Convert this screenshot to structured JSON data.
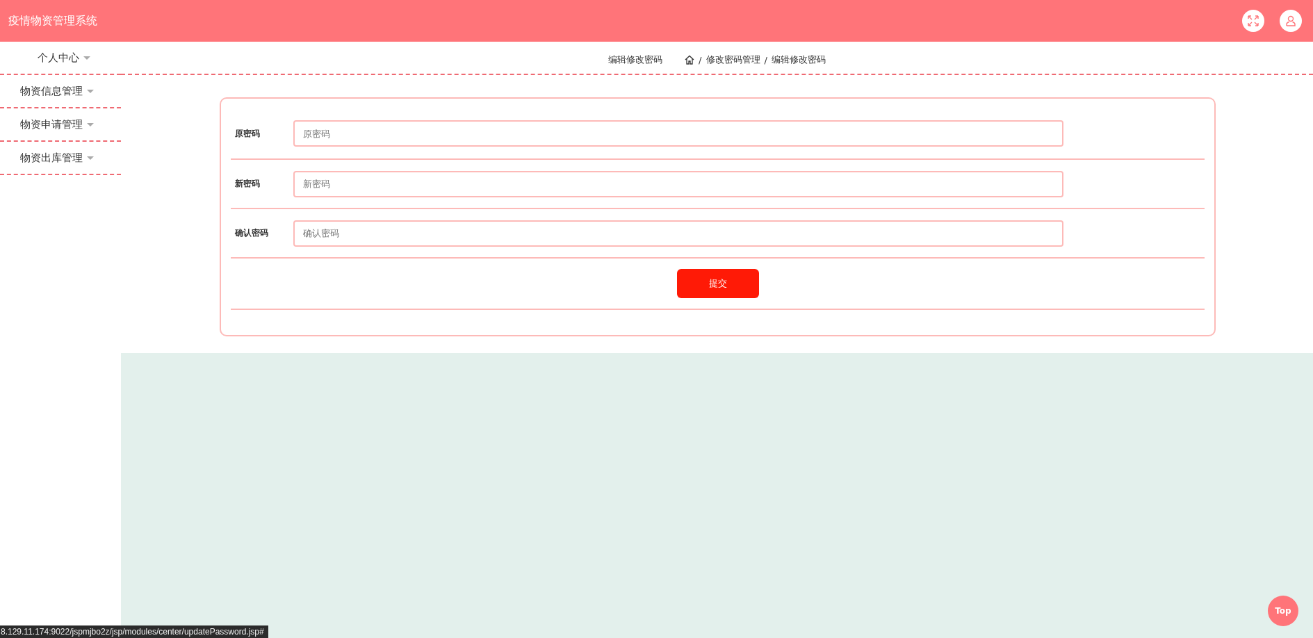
{
  "header": {
    "title": "疫情物资管理系统"
  },
  "sidebar": {
    "items": [
      {
        "label": "个人中心"
      },
      {
        "label": "物资信息管理"
      },
      {
        "label": "物资申请管理"
      },
      {
        "label": "物资出库管理"
      }
    ]
  },
  "breadcrumb": {
    "page_title": "编辑修改密码",
    "separator": "/",
    "trail": [
      "修改密码管理",
      "编辑修改密码"
    ]
  },
  "form": {
    "fields": [
      {
        "label": "原密码",
        "placeholder": "原密码"
      },
      {
        "label": "新密码",
        "placeholder": "新密码"
      },
      {
        "label": "确认密码",
        "placeholder": "确认密码"
      }
    ],
    "submit": "提交"
  },
  "top_button": "Top",
  "status_url": "8.129.11.174:9022/jspmjbo2z/jsp/modules/center/updatePassword.jsp#"
}
